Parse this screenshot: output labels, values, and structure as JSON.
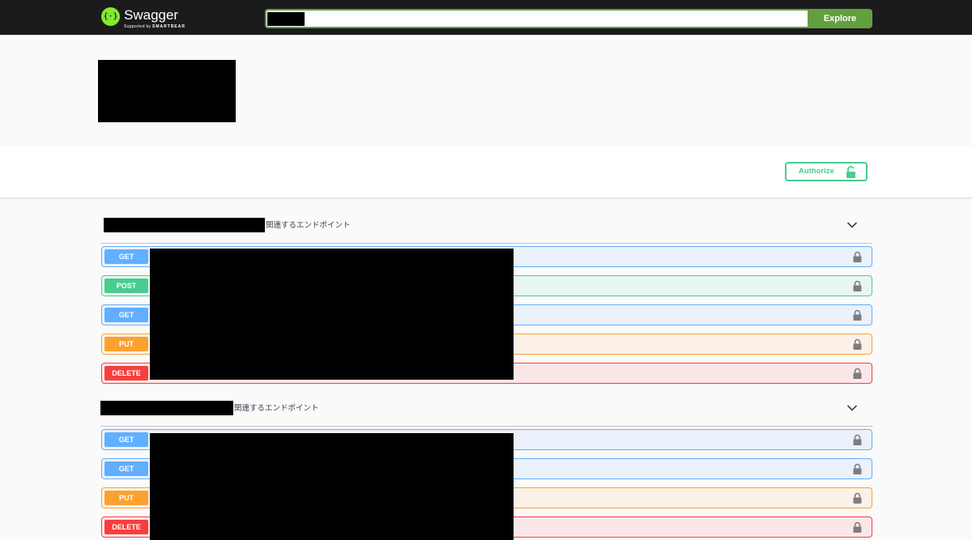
{
  "topbar": {
    "logo_name": "Swagger",
    "logo_sub_prefix": "Supported by",
    "logo_sub_brand": "SMARTBEAR",
    "url_value": "",
    "explore_label": "Explore"
  },
  "scheme": {
    "authorize_label": "Authorize"
  },
  "colors": {
    "get": "#61affe",
    "post": "#49cc90",
    "put": "#fca130",
    "delete": "#f93e3e",
    "accent": "#62a03f"
  },
  "tags": [
    {
      "description": "関連するエンドポイント",
      "operations": [
        {
          "method": "GET"
        },
        {
          "method": "POST"
        },
        {
          "method": "GET"
        },
        {
          "method": "PUT"
        },
        {
          "method": "DELETE"
        }
      ]
    },
    {
      "description": "関連するエンドポイント",
      "operations": [
        {
          "method": "GET"
        },
        {
          "method": "GET"
        },
        {
          "method": "PUT"
        },
        {
          "method": "DELETE"
        }
      ]
    }
  ]
}
